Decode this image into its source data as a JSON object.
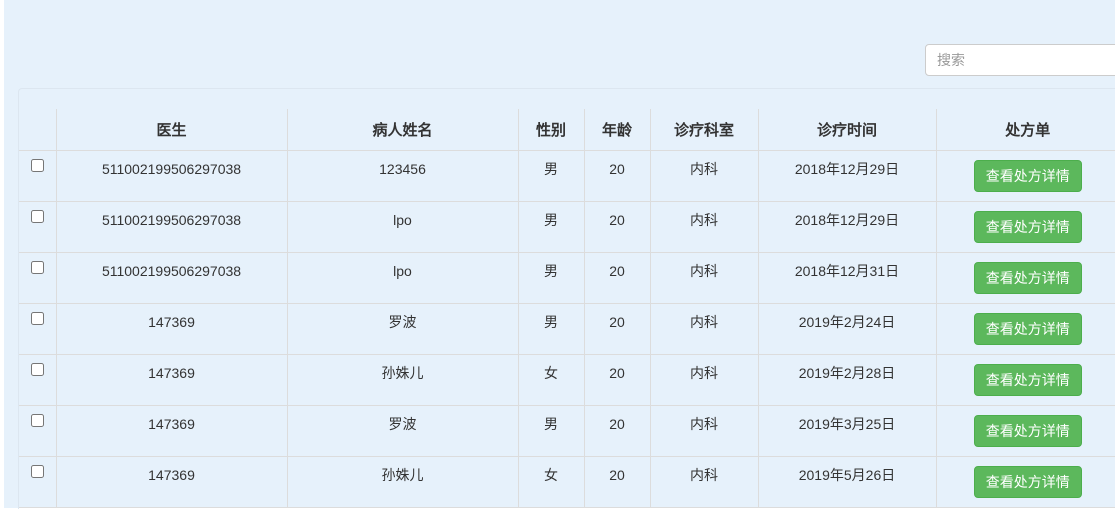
{
  "search": {
    "placeholder": "搜索",
    "value": ""
  },
  "table": {
    "columns": [
      "医生",
      "病人姓名",
      "性别",
      "年龄",
      "诊疗科室",
      "诊疗时间",
      "处方单"
    ],
    "action_label": "查看处方详情",
    "rows": [
      {
        "doctor": "511002199506297038",
        "patient": "123456",
        "gender": "男",
        "age": "20",
        "department": "内科",
        "date": "2018年12月29日"
      },
      {
        "doctor": "511002199506297038",
        "patient": "lpo",
        "gender": "男",
        "age": "20",
        "department": "内科",
        "date": "2018年12月29日"
      },
      {
        "doctor": "511002199506297038",
        "patient": "lpo",
        "gender": "男",
        "age": "20",
        "department": "内科",
        "date": "2018年12月31日"
      },
      {
        "doctor": "147369",
        "patient": "罗波",
        "gender": "男",
        "age": "20",
        "department": "内科",
        "date": "2019年2月24日"
      },
      {
        "doctor": "147369",
        "patient": "孙姝儿",
        "gender": "女",
        "age": "20",
        "department": "内科",
        "date": "2019年2月28日"
      },
      {
        "doctor": "147369",
        "patient": "罗波",
        "gender": "男",
        "age": "20",
        "department": "内科",
        "date": "2019年3月25日"
      },
      {
        "doctor": "147369",
        "patient": "孙姝儿",
        "gender": "女",
        "age": "20",
        "department": "内科",
        "date": "2019年5月26日"
      }
    ]
  }
}
